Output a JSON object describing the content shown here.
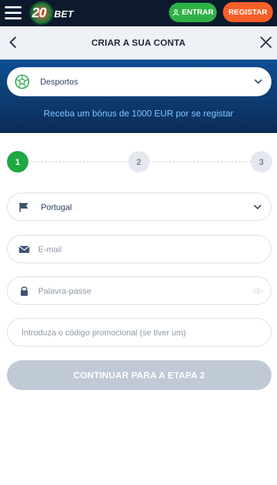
{
  "topbar": {
    "logo_text": "20",
    "logo_suffix": "BET",
    "login_label": "ENTRAR",
    "register_label": "REGISTAR",
    "colors": {
      "bg": "#0d1a2e",
      "login": "#2fb046",
      "register": "#f85e27"
    }
  },
  "header": {
    "title": "CRIAR A SUA CONTA"
  },
  "banner": {
    "sport_selected": "Desportos",
    "bonus_text": "Receba um bónus de 1000 EUR por se registar",
    "colors": {
      "top": "#0f4e93",
      "bottom": "#0b2c57",
      "bonus_text": "#7ecaff"
    }
  },
  "steps": [
    {
      "label": "1",
      "state": "active"
    },
    {
      "label": "2",
      "state": "inactive"
    },
    {
      "label": "3",
      "state": "inactive"
    }
  ],
  "form": {
    "country": {
      "value": "Portugal",
      "icon": "flag-icon"
    },
    "email": {
      "placeholder": "E-mail",
      "value": "",
      "icon": "envelope-icon"
    },
    "password": {
      "placeholder": "Palavra-passe",
      "value": "",
      "icon": "lock-icon"
    },
    "promo": {
      "placeholder": "Introduza o código promocional (se tiver um)",
      "value": ""
    },
    "continue_label": "CONTINUAR PARA A ETAPA 2"
  },
  "colors": {
    "step_active": "#1fa843",
    "continue_disabled": "#c0cad6"
  }
}
